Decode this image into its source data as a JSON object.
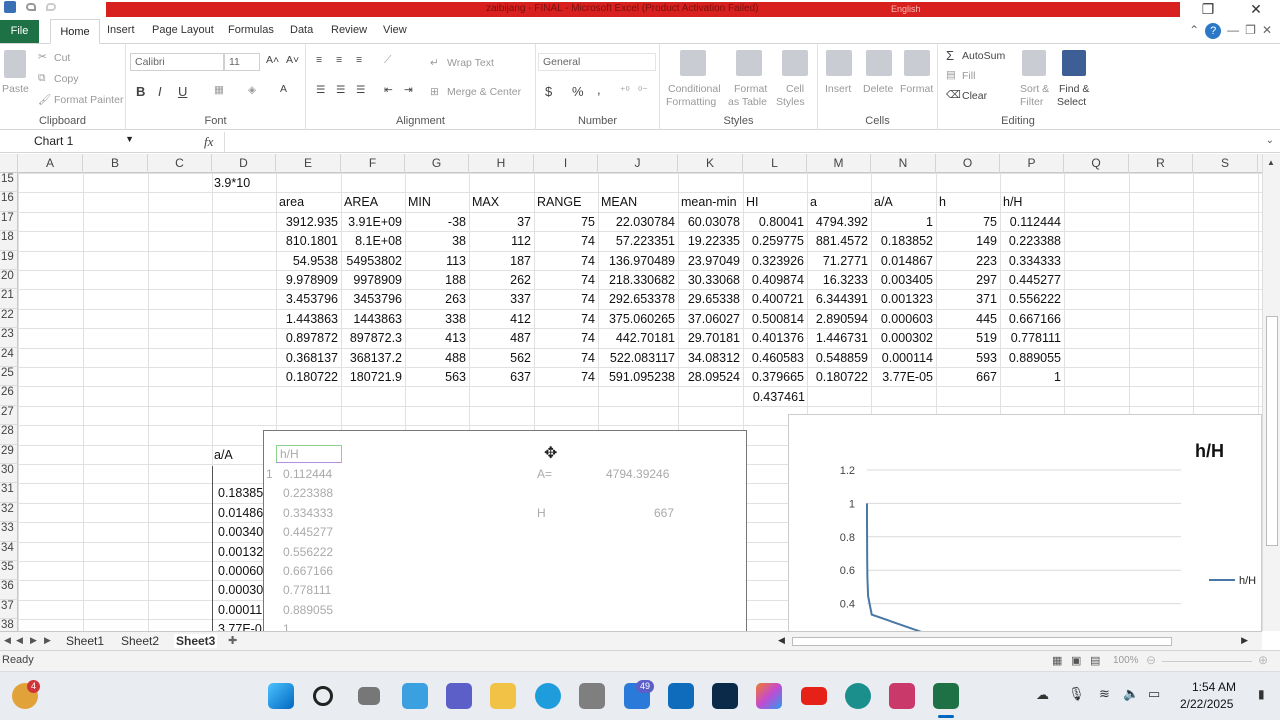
{
  "window": {
    "title": "zaibijang - FINAL - Microsoft Excel (Product Activation Failed)",
    "language": "English"
  },
  "tabs": [
    "File",
    "Home",
    "Insert",
    "Page Layout",
    "Formulas",
    "Data",
    "Review",
    "View"
  ],
  "ribbon": {
    "clipboard": {
      "label": "Clipboard",
      "paste": "Paste",
      "cut": "Cut",
      "copy": "Copy",
      "format_painter": "Format Painter"
    },
    "font": {
      "label": "Font",
      "name": "Calibri",
      "size": "11"
    },
    "alignment": {
      "label": "Alignment",
      "wrap": "Wrap Text",
      "merge": "Merge & Center"
    },
    "number": {
      "label": "Number",
      "format": "General",
      "currency": "$",
      "percent": "%",
      "comma": ","
    },
    "styles": {
      "label": "Styles",
      "cond_1": "Conditional",
      "cond_2": "Formatting",
      "fmt_1": "Format",
      "fmt_2": "as Table",
      "cell_1": "Cell",
      "cell_2": "Styles"
    },
    "cells": {
      "label": "Cells",
      "insert": "Insert",
      "delete": "Delete",
      "format": "Format"
    },
    "editing": {
      "label": "Editing",
      "autosum": "AutoSum",
      "fill": "Fill",
      "clear": "Clear",
      "sort_1": "Sort &",
      "sort_2": "Filter",
      "find_1": "Find &",
      "find_2": "Select"
    }
  },
  "formula_bar": {
    "name_box": "Chart 1",
    "fx": "fx"
  },
  "columns": [
    "A",
    "B",
    "C",
    "D",
    "E",
    "F",
    "G",
    "H",
    "I",
    "J",
    "K",
    "L",
    "M",
    "N",
    "O",
    "P",
    "Q",
    "R",
    "S"
  ],
  "rows": [
    "15",
    "16",
    "17",
    "18",
    "19",
    "20",
    "21",
    "22",
    "23",
    "24",
    "25",
    "26",
    "27",
    "28",
    "29",
    "30",
    "31",
    "32",
    "33",
    "34",
    "35",
    "36",
    "37",
    "38"
  ],
  "cells": {
    "d15": "3.9*10",
    "headers": [
      "area",
      "AREA",
      "MIN",
      "MAX",
      "RANGE",
      "MEAN",
      "mean-min",
      "HI",
      "a",
      "a/A",
      "h",
      "h/H"
    ],
    "table": [
      [
        "3912.935",
        "3.91E+09",
        "-38",
        "37",
        "75",
        "22.030784",
        "60.03078",
        "0.80041",
        "4794.392",
        "1",
        "75",
        "0.112444"
      ],
      [
        "810.1801",
        "8.1E+08",
        "38",
        "112",
        "74",
        "57.223351",
        "19.22335",
        "0.259775",
        "881.4572",
        "0.183852",
        "149",
        "0.223388"
      ],
      [
        "54.9538",
        "54953802",
        "113",
        "187",
        "74",
        "136.970489",
        "23.97049",
        "0.323926",
        "71.2771",
        "0.014867",
        "223",
        "0.334333"
      ],
      [
        "9.978909",
        "9978909",
        "188",
        "262",
        "74",
        "218.330682",
        "30.33068",
        "0.409874",
        "16.3233",
        "0.003405",
        "297",
        "0.445277"
      ],
      [
        "3.453796",
        "3453796",
        "263",
        "337",
        "74",
        "292.653378",
        "29.65338",
        "0.400721",
        "6.344391",
        "0.001323",
        "371",
        "0.556222"
      ],
      [
        "1.443863",
        "1443863",
        "338",
        "412",
        "74",
        "375.060265",
        "37.06027",
        "0.500814",
        "2.890594",
        "0.000603",
        "445",
        "0.667166"
      ],
      [
        "0.897872",
        "897872.3",
        "413",
        "487",
        "74",
        "442.70181",
        "29.70181",
        "0.401376",
        "1.446731",
        "0.000302",
        "519",
        "0.778111"
      ],
      [
        "0.368137",
        "368137.2",
        "488",
        "562",
        "74",
        "522.083117",
        "34.08312",
        "0.460583",
        "0.548859",
        "0.000114",
        "593",
        "0.889055"
      ],
      [
        "0.180722",
        "180721.9",
        "563",
        "637",
        "74",
        "591.095238",
        "28.09524",
        "0.379665",
        "0.180722",
        "3.77E-05",
        "667",
        "1"
      ]
    ],
    "l26": "0.437461",
    "d29": "a/A",
    "d_list": [
      "",
      "0.18385",
      "0.01486",
      "0.00340",
      "0.00132",
      "0.00060",
      "0.00030",
      "0.00011",
      "3.77E-0"
    ]
  },
  "chart1": {
    "header": "h/H",
    "values": [
      "0.112444",
      "0.223388",
      "0.334333",
      "0.445277",
      "0.556222",
      "0.667166",
      "0.778111",
      "0.889055",
      "1"
    ],
    "a_label": "A=",
    "a_value": "4794.39246",
    "h_label": "H",
    "h_value": "667"
  },
  "chart_data": {
    "type": "line",
    "title": "h/H",
    "series": [
      {
        "name": "h/H",
        "x": [
          1,
          0.183852,
          0.014867,
          0.003405,
          0.001323,
          0.000603,
          0.000302,
          0.000114,
          3.77e-05
        ],
        "y": [
          0.112444,
          0.223388,
          0.334333,
          0.445277,
          0.556222,
          0.667166,
          0.778111,
          0.889055,
          1
        ]
      }
    ],
    "yticks": [
      "1.2",
      "1",
      "0.8",
      "0.6",
      "0.4"
    ],
    "ylim": [
      0.2,
      1.2
    ],
    "grid": true,
    "legend": "right"
  },
  "sheets": [
    "Sheet1",
    "Sheet2",
    "Sheet3"
  ],
  "active_sheet": "Sheet3",
  "status": {
    "ready": "Ready",
    "zoom": "100%"
  },
  "taskbar": {
    "time": "1:54 AM",
    "date": "2/22/2025",
    "badge_left": "4",
    "badge_mid": "49"
  }
}
